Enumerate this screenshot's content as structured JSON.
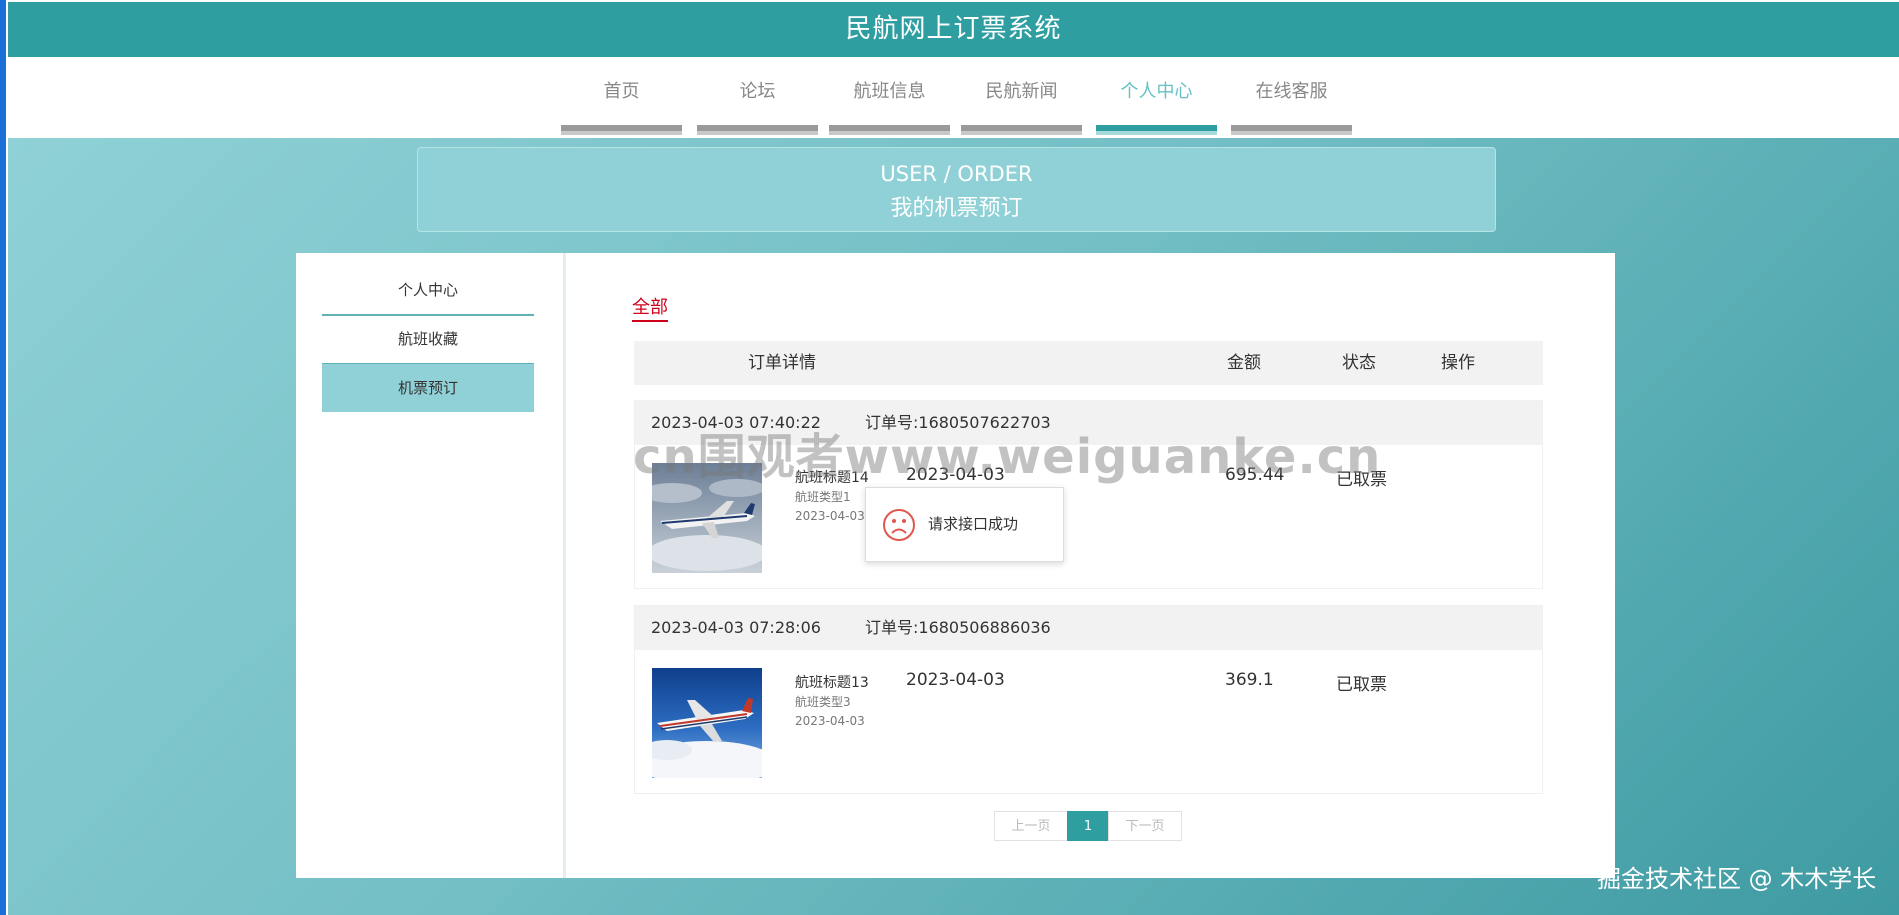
{
  "header": {
    "title": "民航网上订票系统"
  },
  "nav": {
    "items": [
      {
        "label": "首页",
        "active": false
      },
      {
        "label": "论坛",
        "active": false
      },
      {
        "label": "航班信息",
        "active": false
      },
      {
        "label": "民航新闻",
        "active": false
      },
      {
        "label": "个人中心",
        "active": true
      },
      {
        "label": "在线客服",
        "active": false
      }
    ]
  },
  "banner": {
    "en": "USER / ORDER",
    "cn": "我的机票预订"
  },
  "sidebar": {
    "items": [
      {
        "label": "个人中心",
        "active": false
      },
      {
        "label": "航班收藏",
        "active": false
      },
      {
        "label": "机票预订",
        "active": true
      }
    ]
  },
  "tabs": {
    "all": "全部"
  },
  "table_header": {
    "detail": "订单详情",
    "amount": "金额",
    "status": "状态",
    "action": "操作"
  },
  "orders": [
    {
      "time": "2023-04-03 07:40:22",
      "order_no": "订单号:1680507622703",
      "flight_title": "航班标题14",
      "flight_type": "航班类型1",
      "date_small": "2023-04-03",
      "flight_date": "2023-04-03",
      "amount": "695.44",
      "status": "已取票"
    },
    {
      "time": "2023-04-03 07:28:06",
      "order_no": "订单号:1680506886036",
      "flight_title": "航班标题13",
      "flight_type": "航班类型3",
      "date_small": "2023-04-03",
      "flight_date": "2023-04-03",
      "amount": "369.1",
      "status": "已取票"
    }
  ],
  "pager": {
    "prev": "上一页",
    "current": "1",
    "next": "下一页"
  },
  "toast": {
    "message": "请求接口成功",
    "icon": "sad-face-icon"
  },
  "watermark": "cn围观者www.weiguanke.cn",
  "credit": "掘金技术社区 @ 木木学长",
  "colors": {
    "primary": "#2f9ea0",
    "accent_light": "#8fd1d6",
    "active_tab": "#d0021b"
  }
}
